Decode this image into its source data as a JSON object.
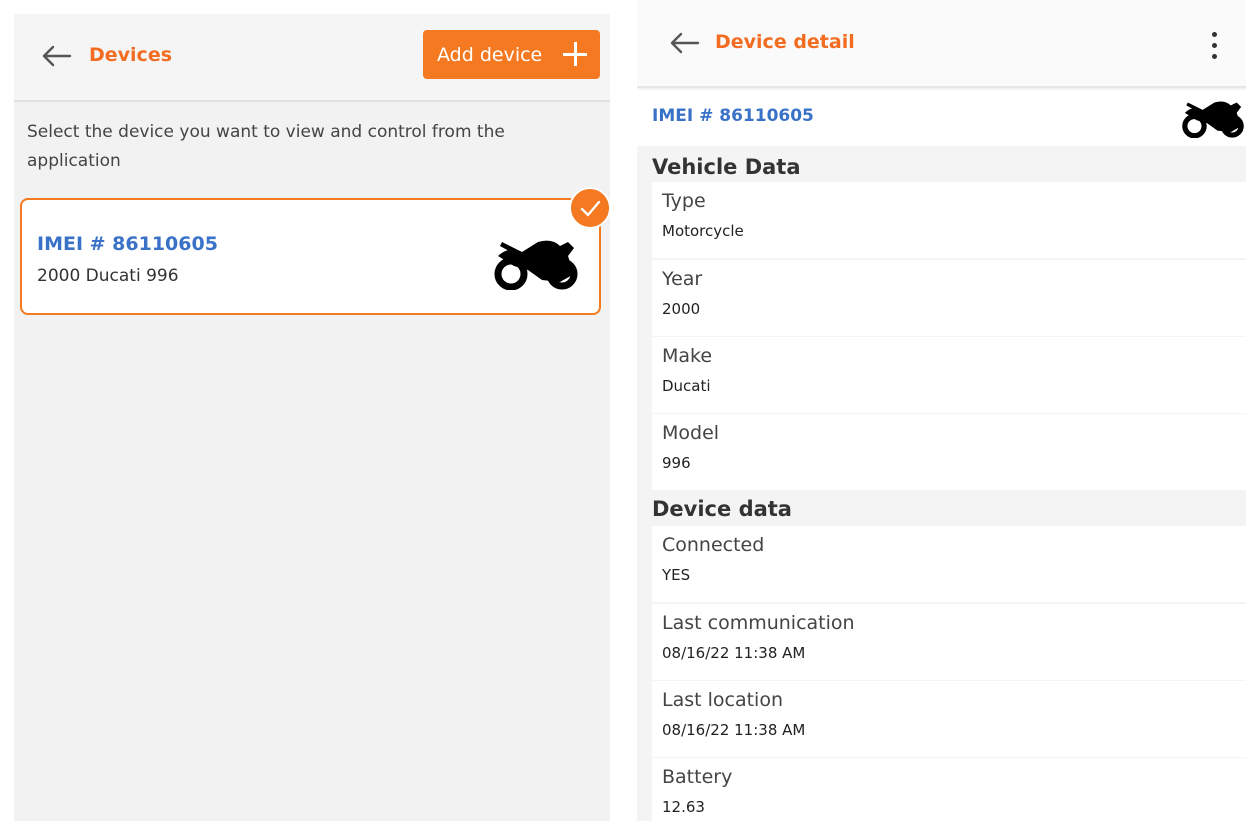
{
  "devices_screen": {
    "title": "Devices",
    "add_button_label": "Add device",
    "instruction": "Select the device you want to view and control from the application",
    "device": {
      "imei": "IMEI # 86110605",
      "description": "2000 Ducati 996",
      "icon": "motorcycle-icon",
      "selected": true
    }
  },
  "detail_screen": {
    "title": "Device detail",
    "imei": "IMEI # 86110605",
    "vehicle_section_title": "Vehicle Data",
    "vehicle_fields": [
      {
        "label": "Type",
        "value": "Motorcycle"
      },
      {
        "label": "Year",
        "value": "2000"
      },
      {
        "label": "Make",
        "value": "Ducati"
      },
      {
        "label": "Model",
        "value": "996"
      }
    ],
    "device_section_title": "Device data",
    "device_fields": [
      {
        "label": "Connected",
        "value": "YES"
      },
      {
        "label": "Last communication",
        "value": "08/16/22 11:38 AM"
      },
      {
        "label": "Last location",
        "value": "08/16/22 11:38 AM"
      },
      {
        "label": "Battery",
        "value": "12.63"
      }
    ]
  },
  "colors": {
    "accent": "#f47920",
    "imei_blue": "#3a72c8"
  }
}
